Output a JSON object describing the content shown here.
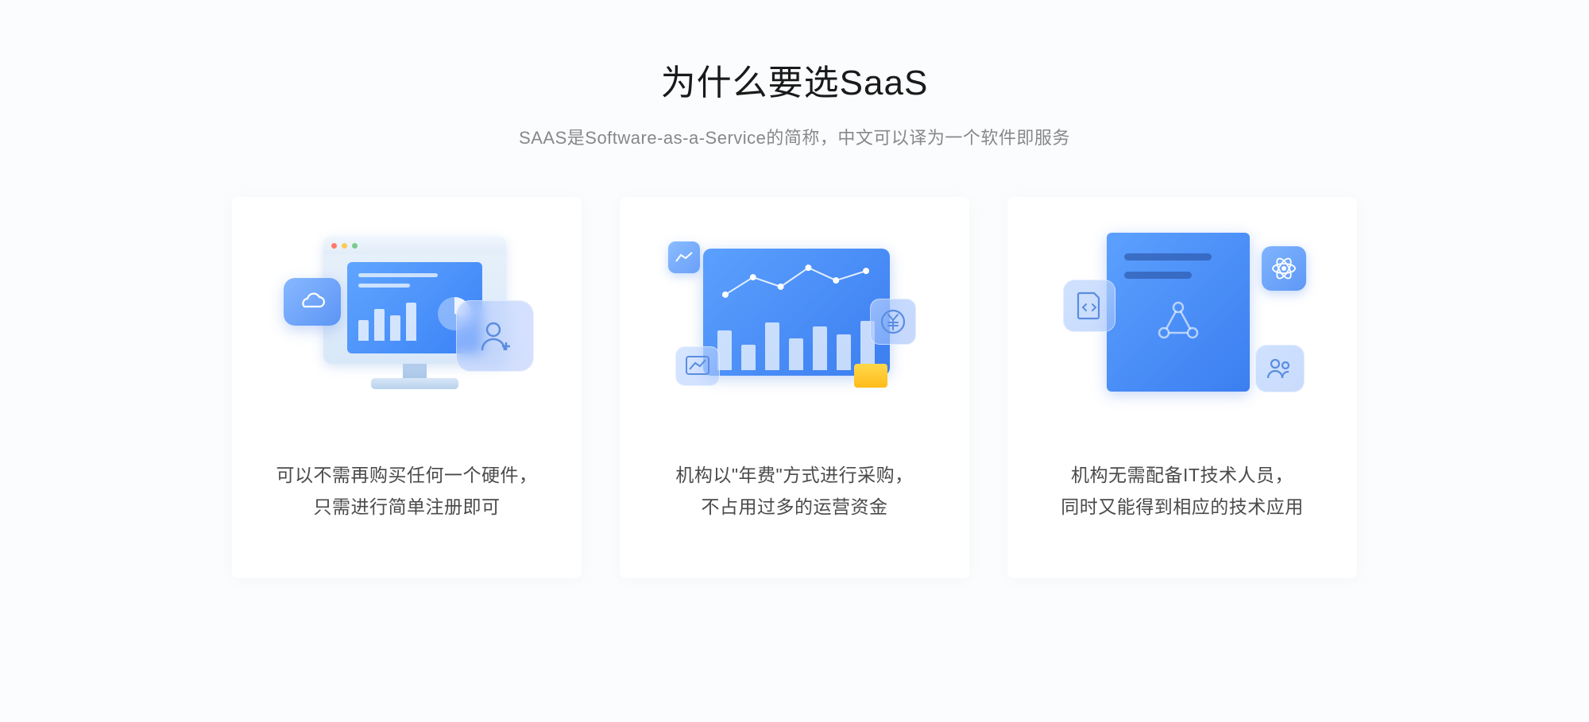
{
  "header": {
    "title": "为什么要选SaaS",
    "subtitle": "SAAS是Software-as-a-Service的简称，中文可以译为一个软件即服务"
  },
  "cards": [
    {
      "line1": "可以不需再购买任何一个硬件，",
      "line2": "只需进行简单注册即可"
    },
    {
      "line1": "机构以\"年费\"方式进行采购，",
      "line2": "不占用过多的运营资金"
    },
    {
      "line1": "机构无需配备IT技术人员，",
      "line2": "同时又能得到相应的技术应用"
    }
  ]
}
